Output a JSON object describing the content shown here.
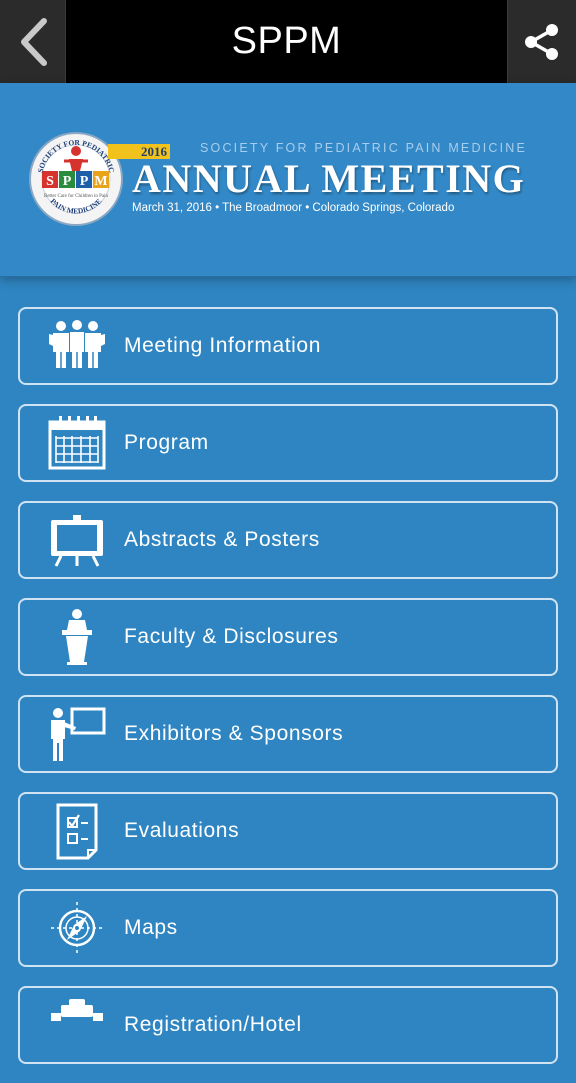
{
  "topbar": {
    "title": "SPPM",
    "back_icon": "back-chevron-icon",
    "share_icon": "share-icon"
  },
  "banner": {
    "year": "2016",
    "society": "SOCIETY FOR PEDIATRIC PAIN MEDICINE",
    "headline": "ANNUAL MEETING",
    "details": "March 31, 2016 • The Broadmoor  •  Colorado Springs, Colorado",
    "logo": {
      "top_text": "SOCIETY FOR PEDIATRIC",
      "bottom_text": "PAIN MEDICINE",
      "letters": [
        "S",
        "P",
        "P",
        "M"
      ],
      "tagline": "Better Care for Children in Pain"
    }
  },
  "menu": {
    "items": [
      {
        "label": "Meeting Information",
        "icon": "people-group-icon"
      },
      {
        "label": "Program",
        "icon": "calendar-icon"
      },
      {
        "label": "Abstracts & Posters",
        "icon": "easel-icon"
      },
      {
        "label": "Faculty & Disclosures",
        "icon": "podium-speaker-icon"
      },
      {
        "label": "Exhibitors & Sponsors",
        "icon": "presenter-board-icon"
      },
      {
        "label": "Evaluations",
        "icon": "checklist-icon"
      },
      {
        "label": "Maps",
        "icon": "compass-icon"
      },
      {
        "label": "Registration/Hotel",
        "icon": "registration-icon"
      }
    ]
  },
  "colors": {
    "background": "#2f85c2",
    "banner": "#3389c7",
    "topbar": "#000000",
    "year_badge": "#f1c21c",
    "border": "#cfe3f3"
  }
}
